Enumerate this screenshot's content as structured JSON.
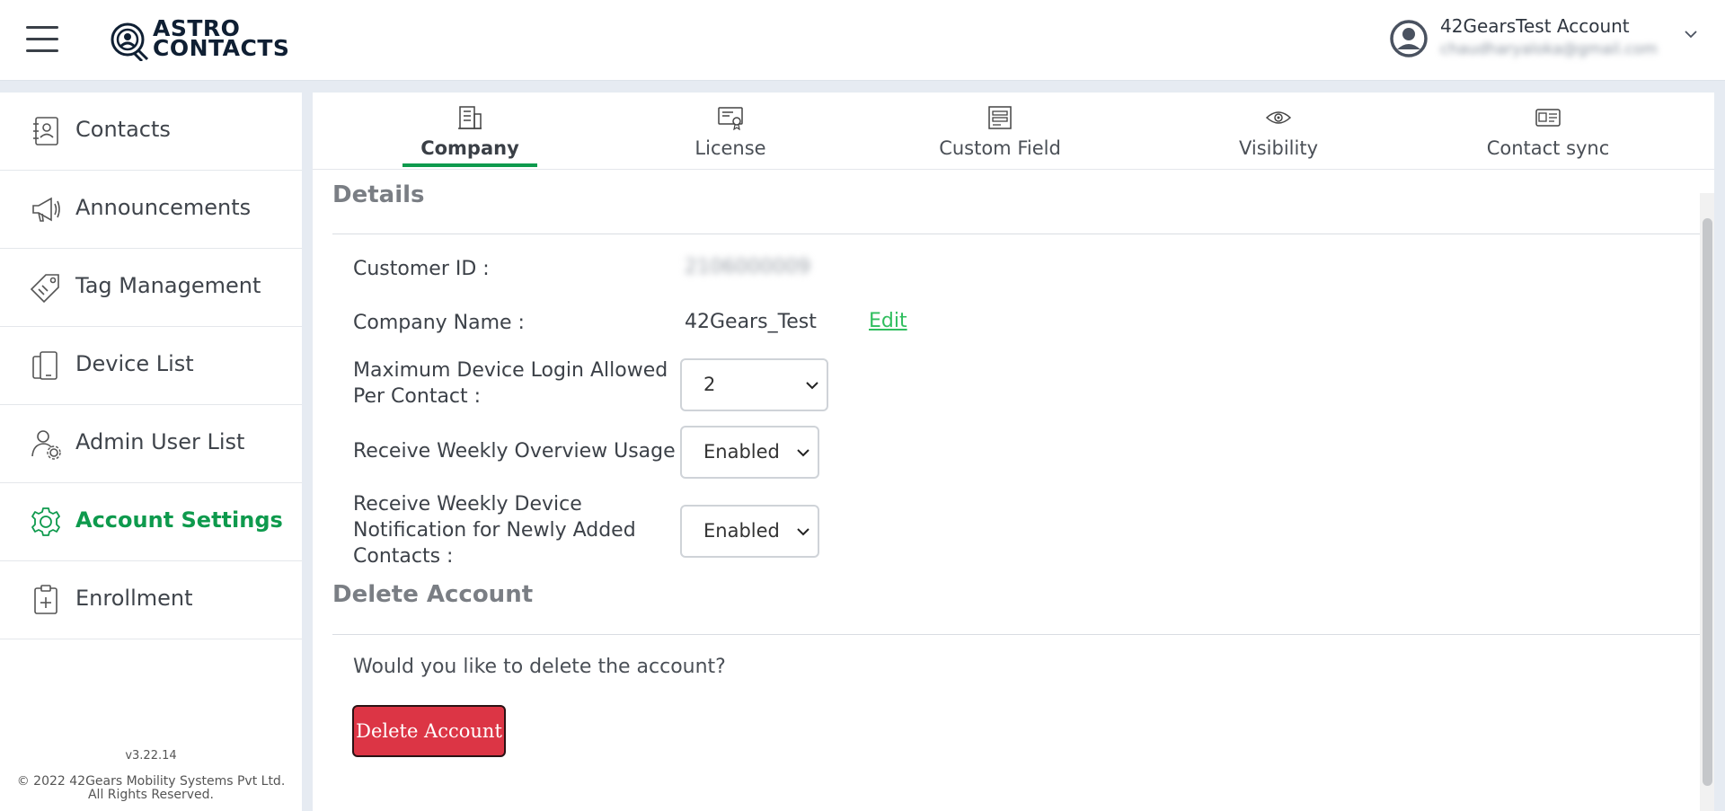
{
  "header": {
    "logo_line1": "ASTRO",
    "logo_line2": "CONTACTS",
    "user_name": "42GearsTest Account",
    "user_email": "chaudharyaloka@gmail.com",
    "icons": {
      "menu": "hamburger-icon",
      "avatar": "user-circle-icon",
      "chevron": "chevron-down-icon"
    }
  },
  "sidebar": {
    "items": [
      {
        "label": "Contacts",
        "icon": "contact-book-icon"
      },
      {
        "label": "Announcements",
        "icon": "megaphone-icon"
      },
      {
        "label": "Tag Management",
        "icon": "tag-icon"
      },
      {
        "label": "Device List",
        "icon": "devices-icon"
      },
      {
        "label": "Admin User List",
        "icon": "user-gear-icon"
      },
      {
        "label": "Account Settings",
        "icon": "gear-icon",
        "active": true
      },
      {
        "label": "Enrollment",
        "icon": "clipboard-plus-icon"
      }
    ],
    "version": "v3.22.14",
    "copyright_line1": "© 2022 42Gears Mobility Systems Pvt Ltd.",
    "copyright_line2": "All Rights Reserved."
  },
  "tabs": [
    {
      "label": "Company",
      "icon": "building-icon",
      "active": true
    },
    {
      "label": "License",
      "icon": "certificate-icon"
    },
    {
      "label": "Custom Field",
      "icon": "form-icon"
    },
    {
      "label": "Visibility",
      "icon": "eye-icon"
    },
    {
      "label": "Contact sync",
      "icon": "id-card-icon"
    }
  ],
  "details": {
    "title": "Details",
    "customer_id_label": "Customer ID :",
    "customer_id_value": "2106000009",
    "company_name_label": "Company Name :",
    "company_name_value": "42Gears_Test",
    "edit_label": "Edit",
    "max_login_label_1": "Maximum Device Login Allowed",
    "max_login_label_2": "Per Contact :",
    "max_login_value": "2",
    "weekly_usage_label": "Receive Weekly Overview Usage :",
    "weekly_usage_value": "Enabled",
    "weekly_notif_label_1": "Receive Weekly Device",
    "weekly_notif_label_2": "Notification for Newly Added",
    "weekly_notif_label_3": "Contacts :",
    "weekly_notif_value": "Enabled"
  },
  "delete_account": {
    "title": "Delete Account",
    "question": "Would you like to delete the account?",
    "button_label": "Delete Account"
  },
  "colors": {
    "accent": "#0e9a4d",
    "link": "#2fbe5e",
    "danger": "#dc3545"
  }
}
